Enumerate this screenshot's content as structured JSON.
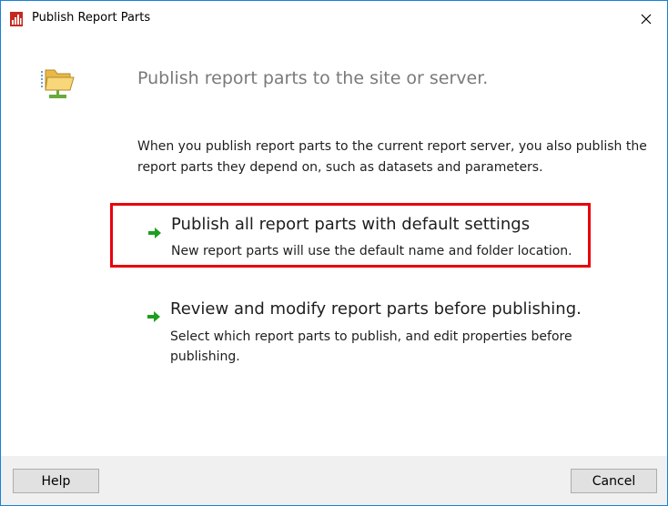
{
  "window": {
    "title": "Publish Report Parts",
    "icon": "report-builder-icon",
    "close_icon": "close-icon"
  },
  "header": {
    "icon": "publish-folder-icon",
    "heading": "Publish report parts to the site or server."
  },
  "intro": "When you publish report parts to the current report server, you also publish the report parts they depend on, such as datasets and parameters.",
  "options": [
    {
      "icon": "green-arrow-icon",
      "title": "Publish all report parts with default settings",
      "description": "New report parts will use the default name and folder location.",
      "highlighted": true
    },
    {
      "icon": "green-arrow-icon",
      "title": "Review and modify report parts before publishing.",
      "description": "Select which report parts to publish, and edit properties before publishing.",
      "highlighted": false
    }
  ],
  "footer": {
    "help_label": "Help",
    "cancel_label": "Cancel"
  },
  "colors": {
    "highlight_border": "#e8000b",
    "arrow_green": "#1e9e1e",
    "heading_gray": "#7a7a7a",
    "footer_bg": "#f0f0f0"
  }
}
